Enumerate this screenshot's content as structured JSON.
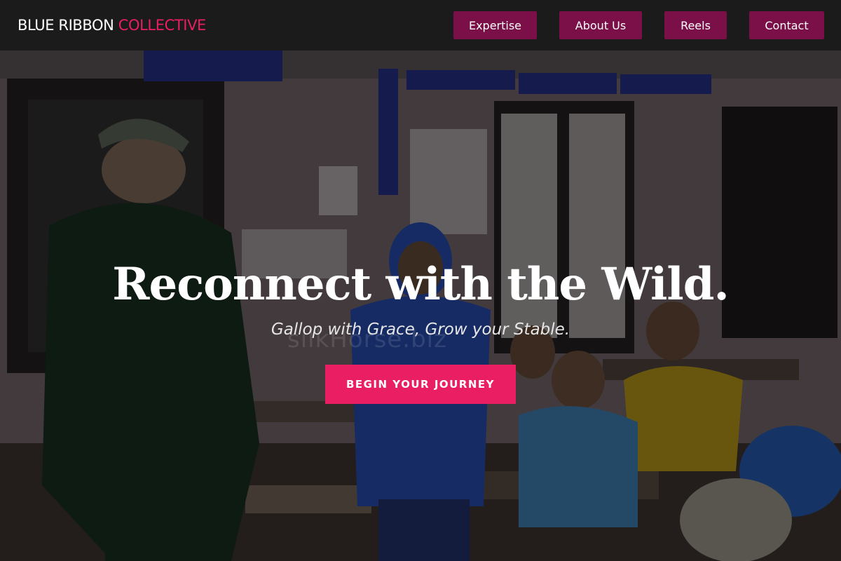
{
  "header": {
    "logo_part1": "BLUE RIBBON",
    "logo_part2": "COLLECTIVE",
    "nav": [
      {
        "label": "Expertise"
      },
      {
        "label": "About Us"
      },
      {
        "label": "Reels"
      },
      {
        "label": "Contact"
      }
    ]
  },
  "hero": {
    "title": "Reconnect with the Wild.",
    "subtitle": "Gallop with Grace, Grow your Stable.",
    "cta_label": "BEGIN YOUR JOURNEY",
    "watermark": "silkHorse.biz"
  },
  "colors": {
    "header_bg": "#1b1b1b",
    "nav_button_bg": "#7b1048",
    "accent": "#e91e63"
  }
}
